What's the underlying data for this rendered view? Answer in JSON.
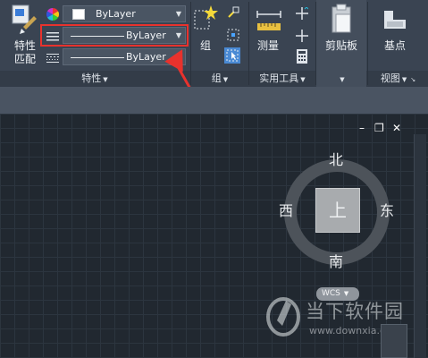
{
  "ribbon": {
    "properties": {
      "match_label": "特性\n匹配",
      "color_value": "ByLayer",
      "linetype_value": "ByLayer",
      "lineweight_value": "ByLayer",
      "panel_label": "特性"
    },
    "groups": {
      "group_label": "组",
      "panel_label": "组"
    },
    "utilities": {
      "measure_label": "测量",
      "panel_label": "实用工具"
    },
    "clipboard": {
      "paste_label": "剪贴板"
    },
    "view": {
      "base_label": "基点",
      "panel_label": "视图"
    }
  },
  "canvas": {
    "viewcube": {
      "face": "上",
      "north": "北",
      "south": "南",
      "east": "东",
      "west": "西",
      "wcs": "WCS"
    },
    "window_controls": {
      "minimize": "–",
      "restore": "❐",
      "close": "✕"
    }
  },
  "watermark": {
    "title": "当下软件园",
    "url": "www.downxia.com"
  },
  "colors": {
    "ribbon_bg": "#3a4452",
    "canvas_bg": "#212830",
    "highlight": "#e8322d"
  }
}
